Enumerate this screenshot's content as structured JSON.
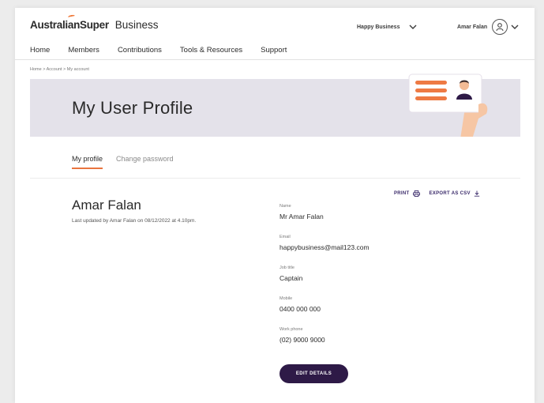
{
  "header": {
    "brand": "AustralianSuper",
    "brand_sub": "Business",
    "org_selector": "Happy Business",
    "user_name": "Amar Falan"
  },
  "nav": {
    "items": [
      "Home",
      "Members",
      "Contributions",
      "Tools & Resources",
      "Support"
    ]
  },
  "breadcrumb": "Home >  Account > My account",
  "banner": {
    "title": "My User Profile"
  },
  "tabs": [
    {
      "label": "My profile",
      "active": true
    },
    {
      "label": "Change password",
      "active": false
    }
  ],
  "actions": {
    "print": "PRINT",
    "export": "EXPORT AS CSV"
  },
  "profile": {
    "name": "Amar Falan",
    "last_updated": "Last updated by Amar Falan on 08/12/2022 at 4.10pm.",
    "fields": [
      {
        "label": "Name",
        "value": "Mr Amar Falan"
      },
      {
        "label": "Email",
        "value": "happybusiness@mail123.com"
      },
      {
        "label": "Job title",
        "value": "Captain"
      },
      {
        "label": "Mobile",
        "value": "0400 000 000"
      },
      {
        "label": "Work phone",
        "value": "(02) 9000 9000"
      }
    ],
    "edit_button": "EDIT DETAILS"
  },
  "colors": {
    "accent": "#e9753f",
    "primary": "#2e1a47",
    "banner_bg": "#e4e2ea"
  }
}
